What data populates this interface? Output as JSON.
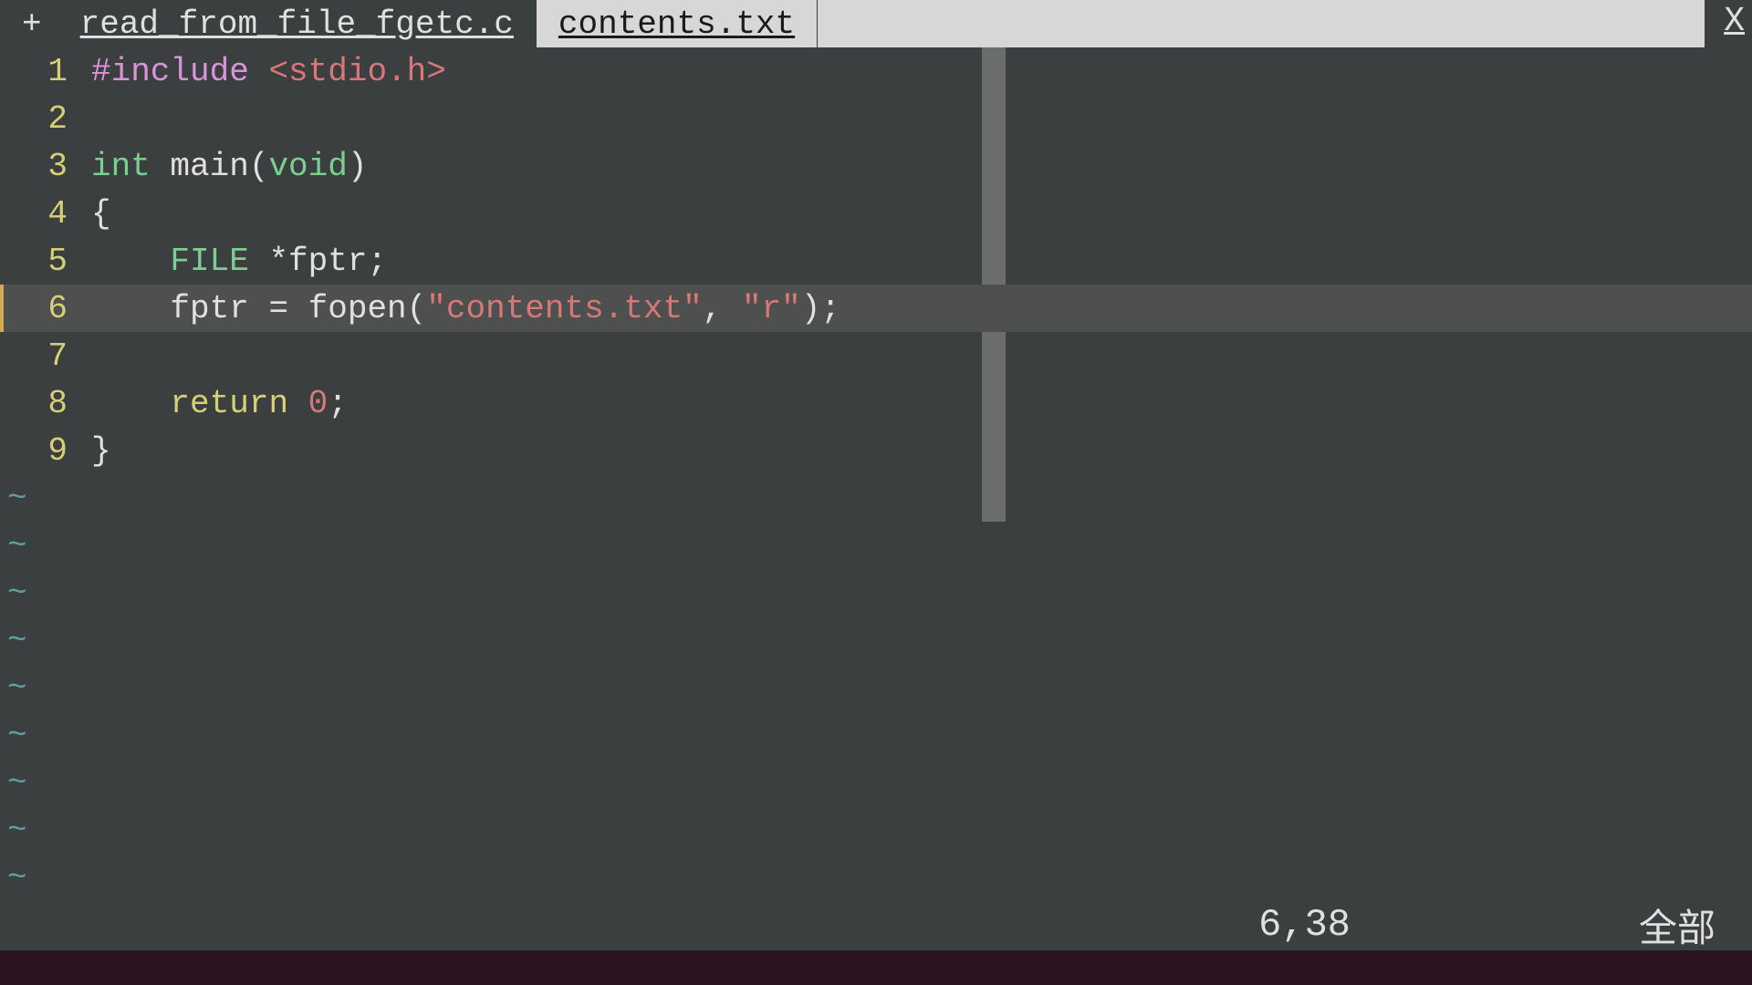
{
  "tabs": {
    "modified_indicator": "+",
    "active": "read_from_file_fgetc.c",
    "inactive": "contents.txt",
    "close": "X"
  },
  "code": {
    "line_numbers": [
      "1",
      "2",
      "3",
      "4",
      "5",
      "6",
      "7",
      "8",
      "9"
    ],
    "l1": {
      "preproc": "#include ",
      "inc": "<stdio.h>"
    },
    "l3": {
      "t1": "int ",
      "fn": "main",
      "p1": "(",
      "t2": "void",
      "p2": ")"
    },
    "l4": "{",
    "l5": {
      "indent": "    ",
      "t1": "FILE ",
      "rest": "*fptr;"
    },
    "l6": {
      "indent": "    ",
      "lhs": "fptr = fopen(",
      "s1": "\"contents.txt\"",
      "comma": ", ",
      "s2": "\"r\"",
      "end": ");"
    },
    "l8": {
      "indent": "    ",
      "kw": "return ",
      "num": "0",
      "semi": ";"
    },
    "l9": "}",
    "tilde": "~"
  },
  "status": {
    "position": "6,38",
    "percent": "全部"
  }
}
